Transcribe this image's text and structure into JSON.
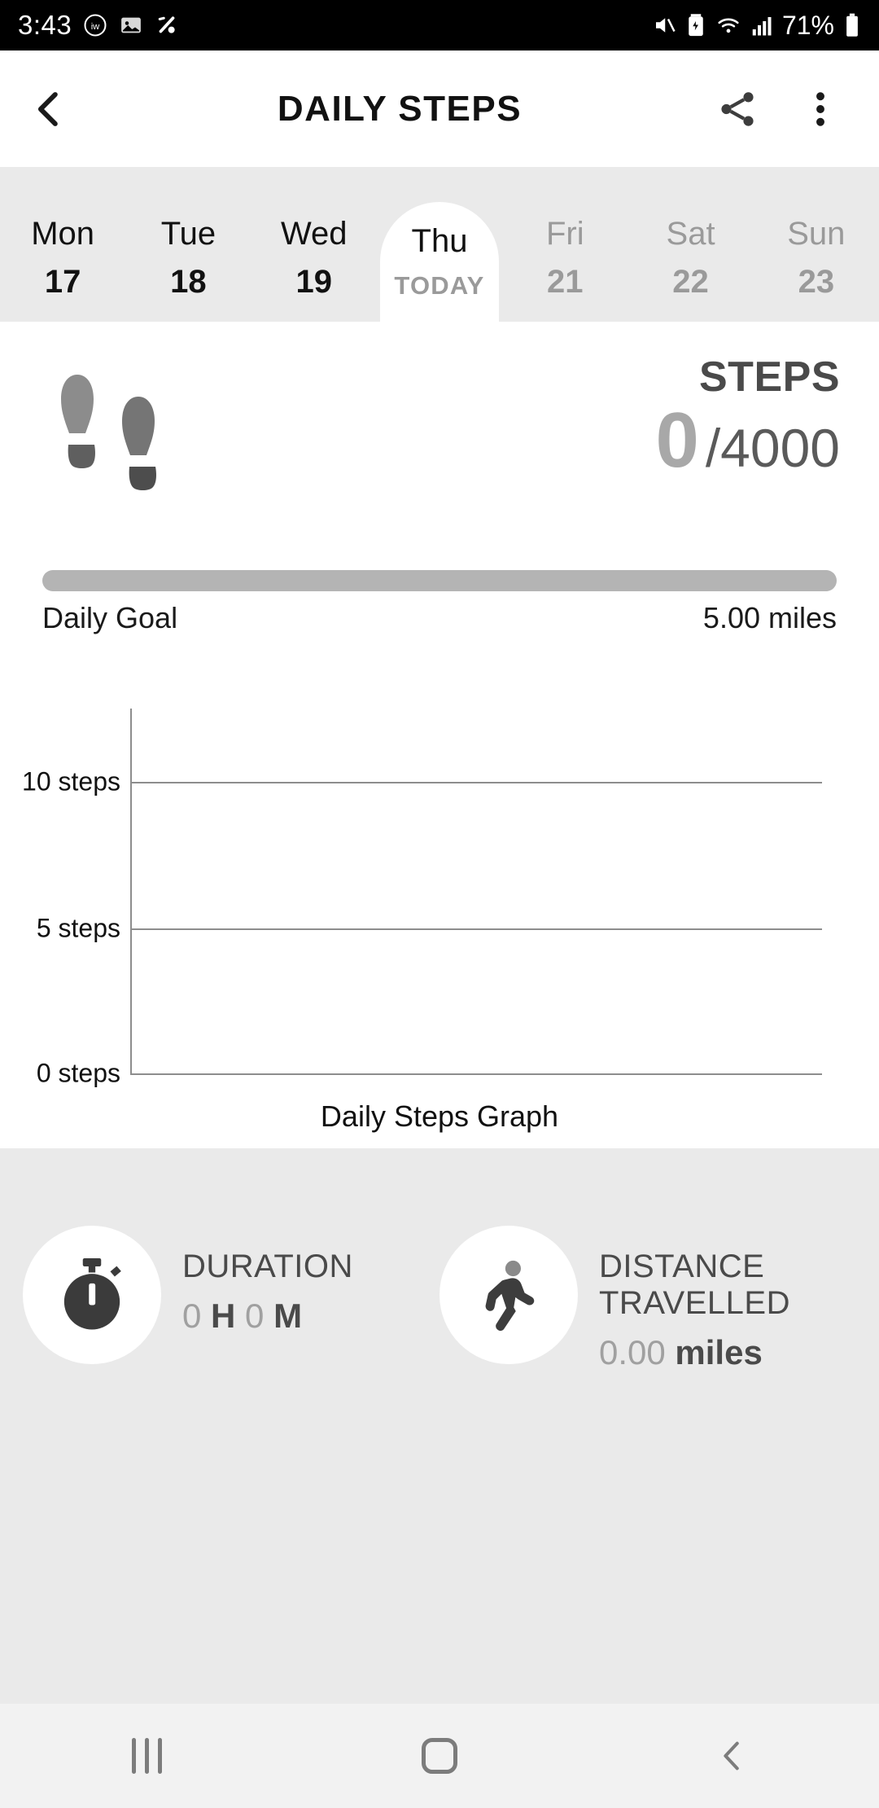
{
  "status_bar": {
    "time": "3:43",
    "battery_percent": "71%",
    "left_icons": [
      "iw-badge-icon",
      "image-icon",
      "percent-icon"
    ],
    "right_icons": [
      "mute-icon",
      "battery-saver-icon",
      "wifi-icon",
      "signal-icon",
      "battery-icon"
    ]
  },
  "header": {
    "title": "DAILY STEPS",
    "back_icon": "chevron-left-icon",
    "share_icon": "share-icon",
    "more_icon": "overflow-menu-icon"
  },
  "day_strip": {
    "days": [
      {
        "name": "Mon",
        "value": "17",
        "state": "past"
      },
      {
        "name": "Tue",
        "value": "18",
        "state": "past"
      },
      {
        "name": "Wed",
        "value": "19",
        "state": "past"
      },
      {
        "name": "Thu",
        "value": "TODAY",
        "state": "today"
      },
      {
        "name": "Fri",
        "value": "21",
        "state": "future"
      },
      {
        "name": "Sat",
        "value": "22",
        "state": "future"
      },
      {
        "name": "Sun",
        "value": "23",
        "state": "future"
      }
    ]
  },
  "summary": {
    "steps_icon": "footprints-icon",
    "steps_label": "STEPS",
    "steps_value": "0",
    "steps_goal": "/4000"
  },
  "progress": {
    "percent": 0,
    "left_label": "Daily Goal",
    "right_label": "5.00 miles"
  },
  "stats": {
    "duration": {
      "icon": "stopwatch-icon",
      "title": "DURATION",
      "hours": "0",
      "hours_unit": "H",
      "minutes": "0",
      "minutes_unit": "M"
    },
    "distance": {
      "icon": "walking-person-icon",
      "title_line1": "DISTANCE",
      "title_line2": "TRAVELLED",
      "value": "0.00",
      "unit": "miles"
    }
  },
  "nav_bar": {
    "recents_icon": "recents-icon",
    "home_icon": "home-icon",
    "back_icon": "back-icon"
  },
  "colors": {
    "strip_bg": "#eaeaea",
    "panel_bg": "#eaeaea",
    "progress_track": "#b4b4b4",
    "muted_text": "#9a9a9a"
  },
  "chart_data": {
    "type": "bar",
    "title": "Daily Steps Graph",
    "xlabel": "",
    "ylabel": "steps",
    "categories": [],
    "values": [],
    "yticks": [
      0,
      5,
      10
    ],
    "ytick_labels": [
      "0 steps",
      "5 steps",
      "10 steps"
    ],
    "ylim": [
      0,
      12
    ],
    "grid": true,
    "legend": "none"
  }
}
